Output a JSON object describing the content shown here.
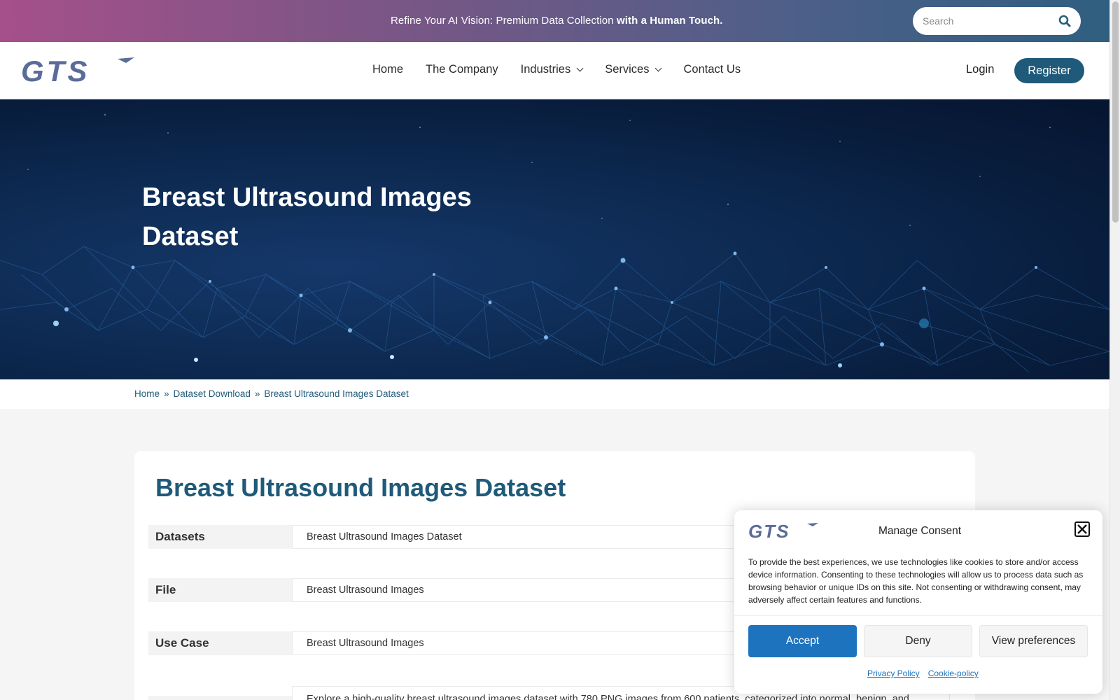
{
  "topbar": {
    "promo_text": "Refine Your AI Vision: Premium Data Collection ",
    "promo_bold": "with a Human Touch.",
    "search_placeholder": "Search"
  },
  "header": {
    "nav": [
      {
        "label": "Home"
      },
      {
        "label": "The Company"
      },
      {
        "label": "Industries"
      },
      {
        "label": "Services"
      },
      {
        "label": "Contact Us"
      }
    ],
    "login": "Login",
    "register": "Register"
  },
  "hero": {
    "title": "Breast Ultrasound Images Dataset"
  },
  "breadcrumb": {
    "items": [
      "Home",
      "Dataset Download",
      "Breast Ultrasound Images Dataset"
    ],
    "separator": "»"
  },
  "card": {
    "title": "Breast Ultrasound Images Dataset",
    "rows": [
      {
        "label": "Datasets",
        "value": "Breast Ultrasound Images Dataset"
      },
      {
        "label": "File",
        "value": "Breast Ultrasound Images"
      },
      {
        "label": "Use Case",
        "value": "Breast Ultrasound Images"
      }
    ],
    "description": "Explore a high-quality breast ultrasound images dataset with 780 PNG images from 600 patients, categorized into normal, benign, and"
  },
  "consent": {
    "title": "Manage Consent",
    "body": "To provide the best experiences, we use technologies like cookies to store and/or access device information. Consenting to these technologies will allow us to process data such as browsing behavior or unique IDs on this site. Not consenting or withdrawing consent, may adversely affect certain features and functions.",
    "accept": "Accept",
    "deny": "Deny",
    "preferences": "View preferences",
    "privacy_link": "Privacy Policy",
    "cookie_link": "Cookie-policy"
  },
  "colors": {
    "brand": "#1f5a7a",
    "accept": "#1e73be",
    "logo": "#5a6c99"
  },
  "icons": {
    "search": "search-icon",
    "close": "close-icon",
    "chevron": "chevron-down-icon"
  }
}
